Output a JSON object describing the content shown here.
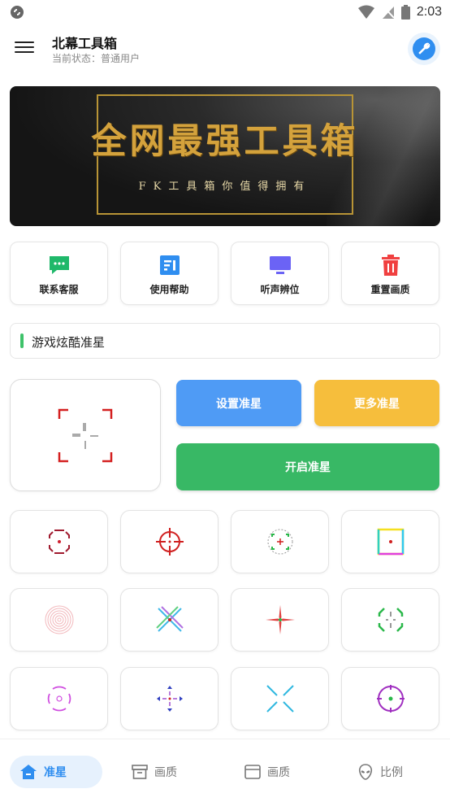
{
  "status_bar": {
    "time": "2:03"
  },
  "app_bar": {
    "title": "北幕工具箱",
    "subtitle": "当前状态：普通用户"
  },
  "banner": {
    "title": "全网最强工具箱",
    "subtitle": "FK工具箱你值得拥有"
  },
  "quick_actions": [
    {
      "label": "联系客服",
      "icon": "chat-icon",
      "color": "#1fb86a"
    },
    {
      "label": "使用帮助",
      "icon": "help-doc-icon",
      "color": "#2f8ef0"
    },
    {
      "label": "听声辨位",
      "icon": "monitor-icon",
      "color": "#6b63f5"
    },
    {
      "label": "重置画质",
      "icon": "trash-icon",
      "color": "#f04040"
    }
  ],
  "section": {
    "title": "游戏炫酷准星"
  },
  "buttons": {
    "set_crosshair": "设置准星",
    "more_crosshair": "更多准星",
    "enable_crosshair": "开启准星"
  },
  "colors": {
    "blue": "#4f9bf5",
    "yellow": "#f6be3c",
    "green": "#38b865",
    "accent": "#2f8ef0"
  },
  "crosshairs": [
    "octagon-dot-crosshair-icon",
    "scope-crosshair-icon",
    "dashed-circle-crosshair-icon",
    "rgb-square-crosshair-icon",
    "concentric-rings-crosshair-icon",
    "x-cross-crosshair-icon",
    "star-cross-crosshair-icon",
    "green-bracket-crosshair-icon",
    "magenta-arc-crosshair-icon",
    "arrow-cross-crosshair-icon",
    "cyan-x-crosshair-icon",
    "purple-circle-crosshair-icon"
  ],
  "bottom_nav": [
    {
      "label": "准星",
      "icon": "home-icon",
      "active": true
    },
    {
      "label": "画质",
      "icon": "archive-box-icon",
      "active": false
    },
    {
      "label": "画质",
      "icon": "window-icon",
      "active": false
    },
    {
      "label": "比例",
      "icon": "alien-icon",
      "active": false
    }
  ]
}
